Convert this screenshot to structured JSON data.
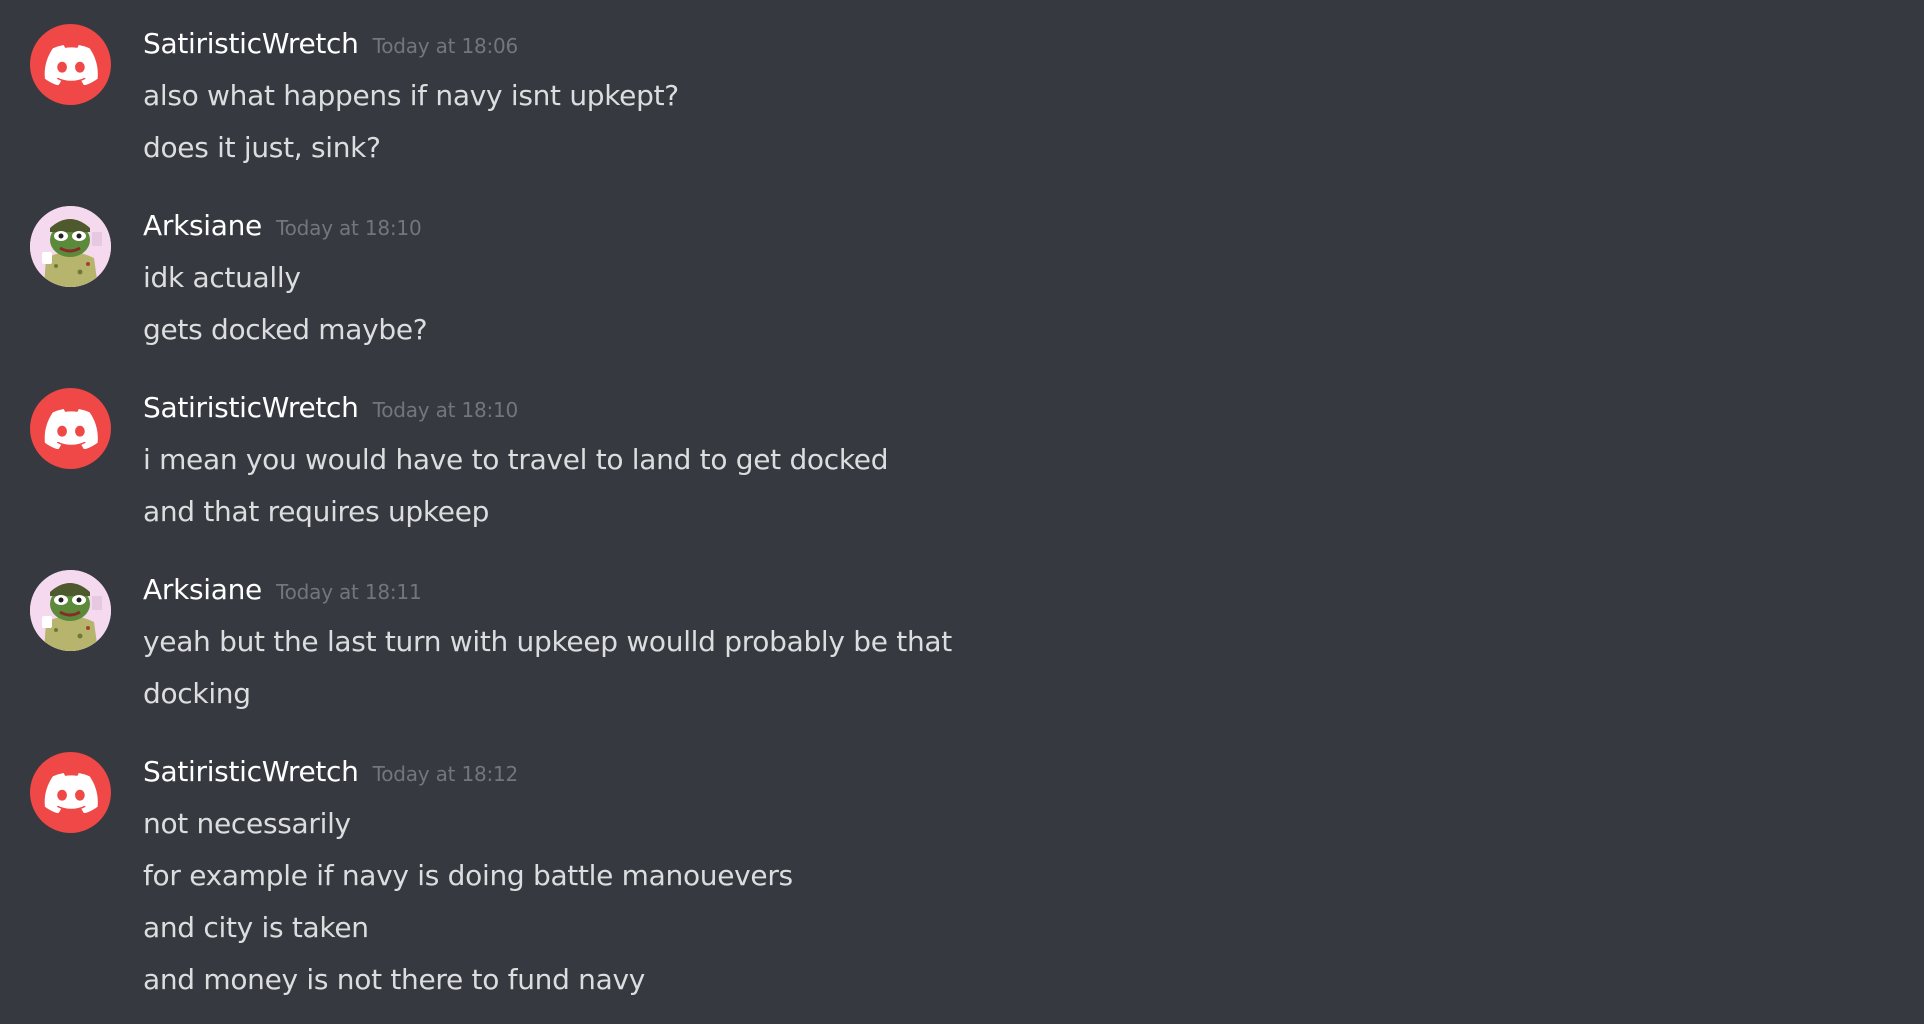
{
  "messages": [
    {
      "author": "SatiristicWretch",
      "avatar": "discord-logo-icon",
      "avatar_color": "#f04747",
      "timestamp": "Today at 18:06",
      "lines": [
        "also what happens if navy isnt upkept?",
        "does it just, sink?"
      ]
    },
    {
      "author": "Arksiane",
      "avatar": "frog-avatar-image",
      "timestamp": "Today at 18:10",
      "lines": [
        "idk actually",
        "gets docked maybe?"
      ]
    },
    {
      "author": "SatiristicWretch",
      "avatar": "discord-logo-icon",
      "avatar_color": "#f04747",
      "timestamp": "Today at 18:10",
      "lines": [
        "i mean you would have to travel to land to get docked",
        "and that requires upkeep"
      ]
    },
    {
      "author": "Arksiane",
      "avatar": "frog-avatar-image",
      "timestamp": "Today at 18:11",
      "lines": [
        "yeah but the last turn with upkeep woulld probably be that",
        "docking"
      ]
    },
    {
      "author": "SatiristicWretch",
      "avatar": "discord-logo-icon",
      "avatar_color": "#f04747",
      "timestamp": "Today at 18:12",
      "lines": [
        "not necessarily",
        "for example if navy is doing battle manouevers",
        "and city is taken",
        "and money is not there to fund navy"
      ]
    }
  ],
  "colors": {
    "background": "#36393f",
    "username": "#ffffff",
    "timestamp": "#72767d",
    "text": "#dcddde"
  }
}
